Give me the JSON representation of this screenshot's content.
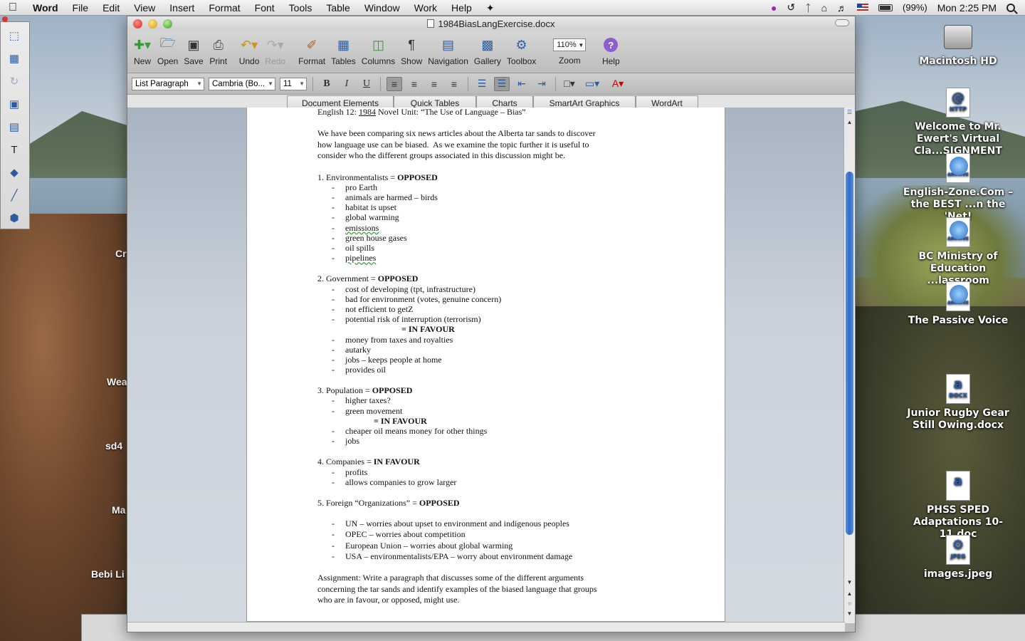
{
  "menubar": {
    "app_name": "Word",
    "items": [
      "File",
      "Edit",
      "View",
      "Insert",
      "Format",
      "Font",
      "Tools",
      "Table",
      "Window",
      "Work",
      "Help"
    ],
    "battery": "(99%)",
    "clock": "Mon 2:25 PM"
  },
  "window": {
    "title": "1984BiasLangExercise.docx"
  },
  "toolbar": {
    "new_label": "New",
    "open_label": "Open",
    "save_label": "Save",
    "print_label": "Print",
    "undo_label": "Undo",
    "redo_label": "Redo",
    "format_label": "Format",
    "tables_label": "Tables",
    "columns_label": "Columns",
    "show_label": "Show",
    "navigation_label": "Navigation",
    "gallery_label": "Gallery",
    "toolbox_label": "Toolbox",
    "zoom_value": "110%",
    "zoom_label": "Zoom",
    "help_label": "Help"
  },
  "format_bar": {
    "style": "List Paragraph",
    "font": "Cambria (Bo...",
    "size": "11",
    "bold": "B",
    "italic": "I",
    "underline": "U"
  },
  "ribbon_tabs": [
    "Document Elements",
    "Quick Tables",
    "Charts",
    "SmartArt Graphics",
    "WordArt"
  ],
  "document": {
    "heading_prefix": "English 12: ",
    "heading_novel": "1984",
    "heading_rest": " Novel Unit: “The Use of Language – Bias”",
    "intro": [
      "We have been comparing six news articles about the Alberta tar sands to discover",
      "how language use can be biased.  As we examine the topic further it is useful to",
      "consider who the different groups associated in this discussion might be."
    ],
    "sections": [
      {
        "title": "1.  Environmentalists = ",
        "stance": "OPPOSED",
        "items": [
          "pro Earth",
          "animals are harmed – birds",
          "habitat is upset",
          "global warming",
          "emissions",
          "green house gases",
          "oil spills",
          "pipelines"
        ]
      },
      {
        "title": "2.  Government = ",
        "stance": "OPPOSED",
        "items": [
          "cost of developing (tpt, infrastructure)",
          "bad for environment (votes, genuine concern)",
          "not efficient to getZ",
          "potential risk of interruption (terrorism)"
        ],
        "favour": "= IN FAVOUR",
        "favour_items": [
          "money from taxes and royalties",
          "autarky",
          "jobs – keeps people at home",
          "provides oil"
        ]
      },
      {
        "title": "3.  Population = ",
        "stance": "OPPOSED",
        "items": [
          "higher taxes?",
          "green movement"
        ],
        "favour": "= IN FAVOUR",
        "favour_items": [
          "cheaper oil means money for other things",
          "jobs"
        ]
      },
      {
        "title": "4.  Companies = ",
        "stance": "IN FAVOUR",
        "items": [
          "profits",
          "allows companies to grow larger"
        ]
      },
      {
        "title": "5.  Foreign “Organizations” = ",
        "stance": "OPPOSED",
        "items": [
          "UN – worries about upset to environment and indigenous peoples",
          "OPEC – worries about competition",
          "European Union – worries about global warming",
          "USA – environmentalists/EPA – worry about environment damage"
        ]
      }
    ],
    "assignment": [
      "Assignment: Write a paragraph that discusses some of the different arguments",
      "concerning the tar sands and identify examples of the biased language that groups",
      "who are in favour, or opposed, might use."
    ]
  },
  "desktop_icons": [
    {
      "label": "Macintosh HD",
      "kind": "drive"
    },
    {
      "label": "Welcome to Mr. Ewert's Virtual Cla...SIGNMENT",
      "kind": "HTTP"
    },
    {
      "label": "English-Zone.Com – the BEST ...n the 'Net!",
      "kind": "ARCHIVE"
    },
    {
      "label": "BC Ministry of Education ...lassroom",
      "kind": "ARCHIVE"
    },
    {
      "label": "The Passive Voice",
      "kind": "ARCHIVE"
    },
    {
      "label": "Junior Rugby Gear Still Owing.docx",
      "kind": "DOCX"
    },
    {
      "label": "PHSS SPED Adaptations 10-11.doc",
      "kind": "doc"
    },
    {
      "label": "images.jpeg",
      "kind": "JPEG"
    }
  ],
  "behind_labels": [
    "Cr",
    "Wea",
    "sd4",
    "Ma",
    "Bebi Li"
  ]
}
